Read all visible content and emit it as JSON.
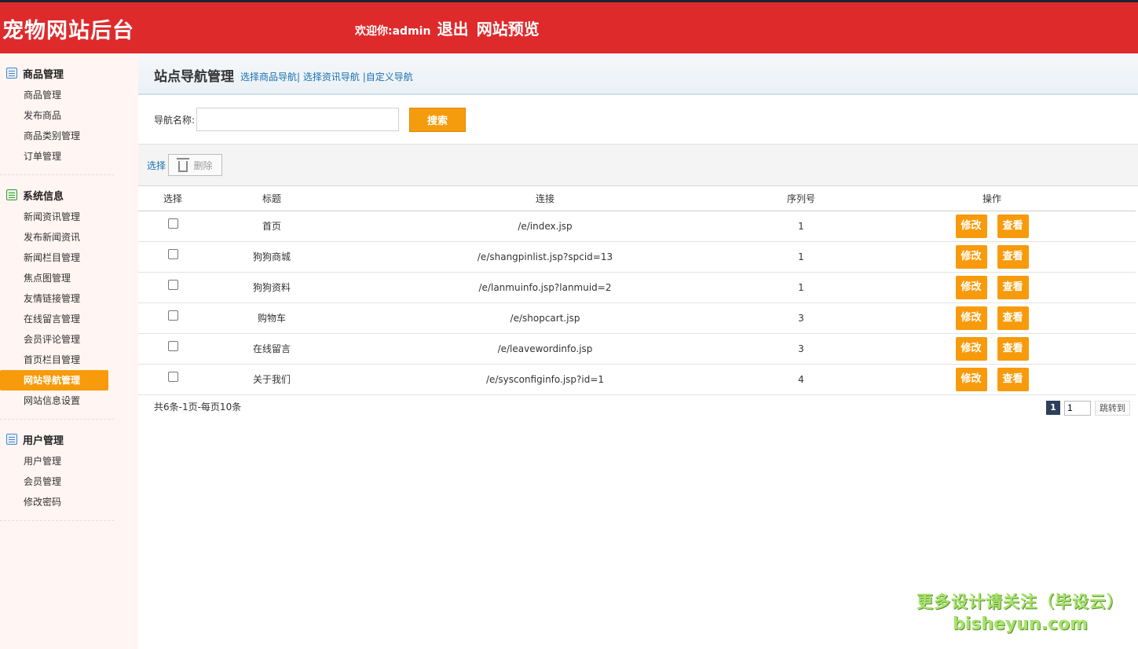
{
  "header": {
    "brand": "宠物网站后台",
    "welcome": "欢迎你:admin",
    "logout": "退出",
    "preview": "网站预览"
  },
  "sidebar": {
    "groups": [
      {
        "title": "商品管理",
        "items": [
          "商品管理",
          "发布商品",
          "商品类别管理",
          "订单管理"
        ]
      },
      {
        "title": "系统信息",
        "items": [
          "新闻资讯管理",
          "发布新闻资讯",
          "新闻栏目管理",
          "焦点图管理",
          "友情链接管理",
          "在线留言管理",
          "会员评论管理",
          "首页栏目管理",
          "网站导航管理",
          "网站信息设置"
        ]
      },
      {
        "title": "用户管理",
        "items": [
          "用户管理",
          "会员管理",
          "修改密码"
        ]
      }
    ],
    "active_item": "网站导航管理"
  },
  "page": {
    "title": "站点导航管理",
    "link1": "选择商品导航|",
    "link2": " 选择资讯导航",
    "link3": " |自定义导航"
  },
  "search": {
    "label": "导航名称:",
    "value": "",
    "placeholder": "",
    "button": "搜索"
  },
  "toolbar": {
    "select": "选择",
    "delete": "删除"
  },
  "table": {
    "columns": [
      "选择",
      "标题",
      "连接",
      "序列号",
      "操作"
    ],
    "rows": [
      {
        "title": "首页",
        "link": "/e/index.jsp",
        "seq": "1"
      },
      {
        "title": "狗狗商城",
        "link": "/e/shangpinlist.jsp?spcid=13",
        "seq": "1"
      },
      {
        "title": "狗狗资料",
        "link": "/e/lanmuinfo.jsp?lanmuid=2",
        "seq": "1"
      },
      {
        "title": "购物车",
        "link": "/e/shopcart.jsp",
        "seq": "3"
      },
      {
        "title": "在线留言",
        "link": "/e/leavewordinfo.jsp",
        "seq": "3"
      },
      {
        "title": "关于我们",
        "link": "/e/sysconfiginfo.jsp?id=1",
        "seq": "4"
      }
    ],
    "edit_label": "修改",
    "view_label": "查看"
  },
  "pagination": {
    "summary": "共6条-1页-每页10条",
    "current": "1",
    "input_value": "1",
    "go_label": "跳转到"
  },
  "watermark": {
    "line1": "更多设计请关注（毕设云）",
    "line2": "bisheyun.com"
  },
  "colors": {
    "header_bg": "#df2a2c",
    "accent_orange": "#f79b0c",
    "link_blue": "#1a6fb0",
    "sidebar_bg": "#fff5f2"
  }
}
